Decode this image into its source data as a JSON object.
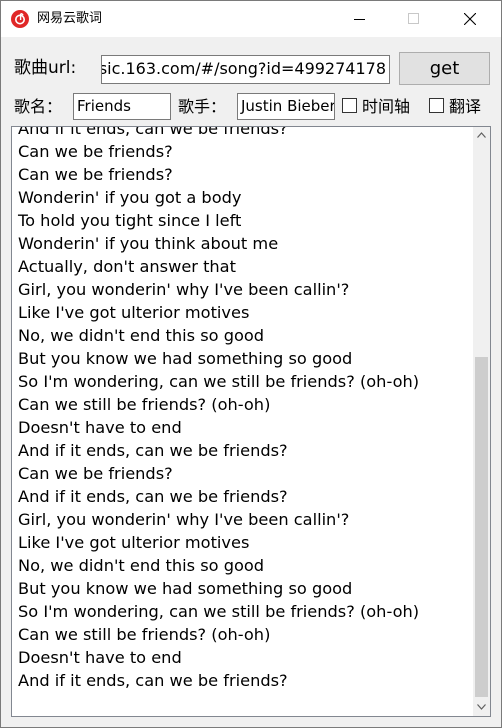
{
  "window": {
    "title": "网易云歌词",
    "icon": "netease-music-icon"
  },
  "form": {
    "url_label": "歌曲url:",
    "url_value": "sic.163.com/#/song?id=499274178",
    "get_label": "get",
    "name_label": "歌名：",
    "name_value": "Friends",
    "singer_label": "歌手：",
    "singer_value": "Justin Bieber",
    "timeline_label": "时间轴",
    "timeline_checked": false,
    "translate_label": "翻译",
    "translate_checked": false
  },
  "lyrics": [
    "And if it ends, can we be friends?",
    "Can we be friends?",
    "Can we be friends?",
    "Wonderin' if you got a body",
    "To hold you tight since I left",
    "Wonderin' if you think about me",
    "Actually, don't answer that",
    "Girl, you wonderin' why I've been callin'?",
    "Like I've got ulterior motives",
    "No, we didn't end this so good",
    "But you know we had something so good",
    "So I'm wondering, can we still be friends? (oh-oh)",
    "Can we still be friends? (oh-oh)",
    "Doesn't have to end",
    "And if it ends, can we be friends?",
    "Can we be friends?",
    "And if it ends, can we be friends?",
    "Girl, you wonderin' why I've been callin'?",
    "Like I've got ulterior motives",
    "No, we didn't end this so good",
    "But you know we had something so good",
    "So I'm wondering, can we still be friends? (oh-oh)",
    "Can we still be friends? (oh-oh)",
    "Doesn't have to end",
    "And if it ends, can we be friends?"
  ],
  "colors": {
    "accent": "#e02727",
    "window_bg": "#f0f0f0",
    "scroll_thumb": "#cdcdcd"
  }
}
